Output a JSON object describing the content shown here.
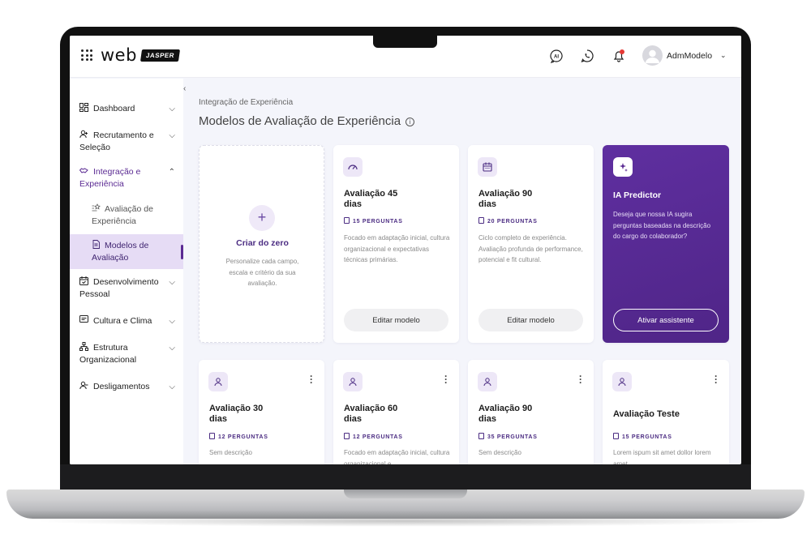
{
  "header": {
    "logo_word": "web",
    "logo_badge": "JASPER",
    "ai_icon_text": "AI",
    "user_name": "AdmModelo"
  },
  "sidebar": {
    "items": [
      {
        "label": "Dashboard",
        "icon": "dashboard-icon"
      },
      {
        "label": "Recrutamento e Seleção",
        "icon": "user-plus-icon"
      },
      {
        "label": "Integração e Experiência",
        "icon": "handshake-icon"
      },
      {
        "label": "Desenvolvimento Pessoal",
        "icon": "calendar-check-icon"
      },
      {
        "label": "Cultura e Clima",
        "icon": "chat-icon"
      },
      {
        "label": "Estrutura Organizacional",
        "icon": "org-chart-icon"
      },
      {
        "label": "Desligamentos",
        "icon": "user-minus-icon"
      }
    ],
    "sub_items": [
      {
        "label": "Avaliação de Experiência",
        "icon": "star-list-icon"
      },
      {
        "label": "Modelos de Avaliação",
        "icon": "document-icon"
      }
    ]
  },
  "main": {
    "breadcrumb": "Integração de Experiência",
    "title": "Modelos de Avaliação de Experiência",
    "create_card": {
      "title": "Criar do zero",
      "description": "Personalize cada campo, escala e critério da sua avaliação."
    },
    "top_cards": [
      {
        "title": "Avaliação 45 dias",
        "count": "15 PERGUNTAS",
        "description": "Focado em adaptação inicial, cultura organizacional e expectativas técnicas primárias.",
        "button": "Editar modelo",
        "icon": "speedometer-icon"
      },
      {
        "title": "Avaliação 90 dias",
        "count": "20 PERGUNTAS",
        "description": "Ciclo completo de experiência. Avaliação profunda de performance, potencial e fit cultural.",
        "button": "Editar modelo",
        "icon": "calendar-icon"
      }
    ],
    "ia_card": {
      "title": "IA Predictor",
      "description": "Deseja que nossa IA sugira perguntas baseadas na descrição do cargo do colaborador?",
      "button": "Ativar assistente"
    },
    "bottom_cards": [
      {
        "title": "Avaliação 30 dias",
        "count": "12 PERGUNTAS",
        "description": "Sem descrição"
      },
      {
        "title": "Avaliação 60 dias",
        "count": "12 PERGUNTAS",
        "description": "Focado em adaptação inicial, cultura organizacional e"
      },
      {
        "title": "Avaliação 90 dias",
        "count": "35 PERGUNTAS",
        "description": "Sem descrição"
      },
      {
        "title": "Avaliação Teste",
        "count": "15 PERGUNTAS",
        "description": "Lorem ispum sit amet dollor lorem amet"
      }
    ]
  },
  "colors": {
    "accent": "#5b2b93",
    "accent_light": "#e6dcf5",
    "notification": "#e53935"
  }
}
